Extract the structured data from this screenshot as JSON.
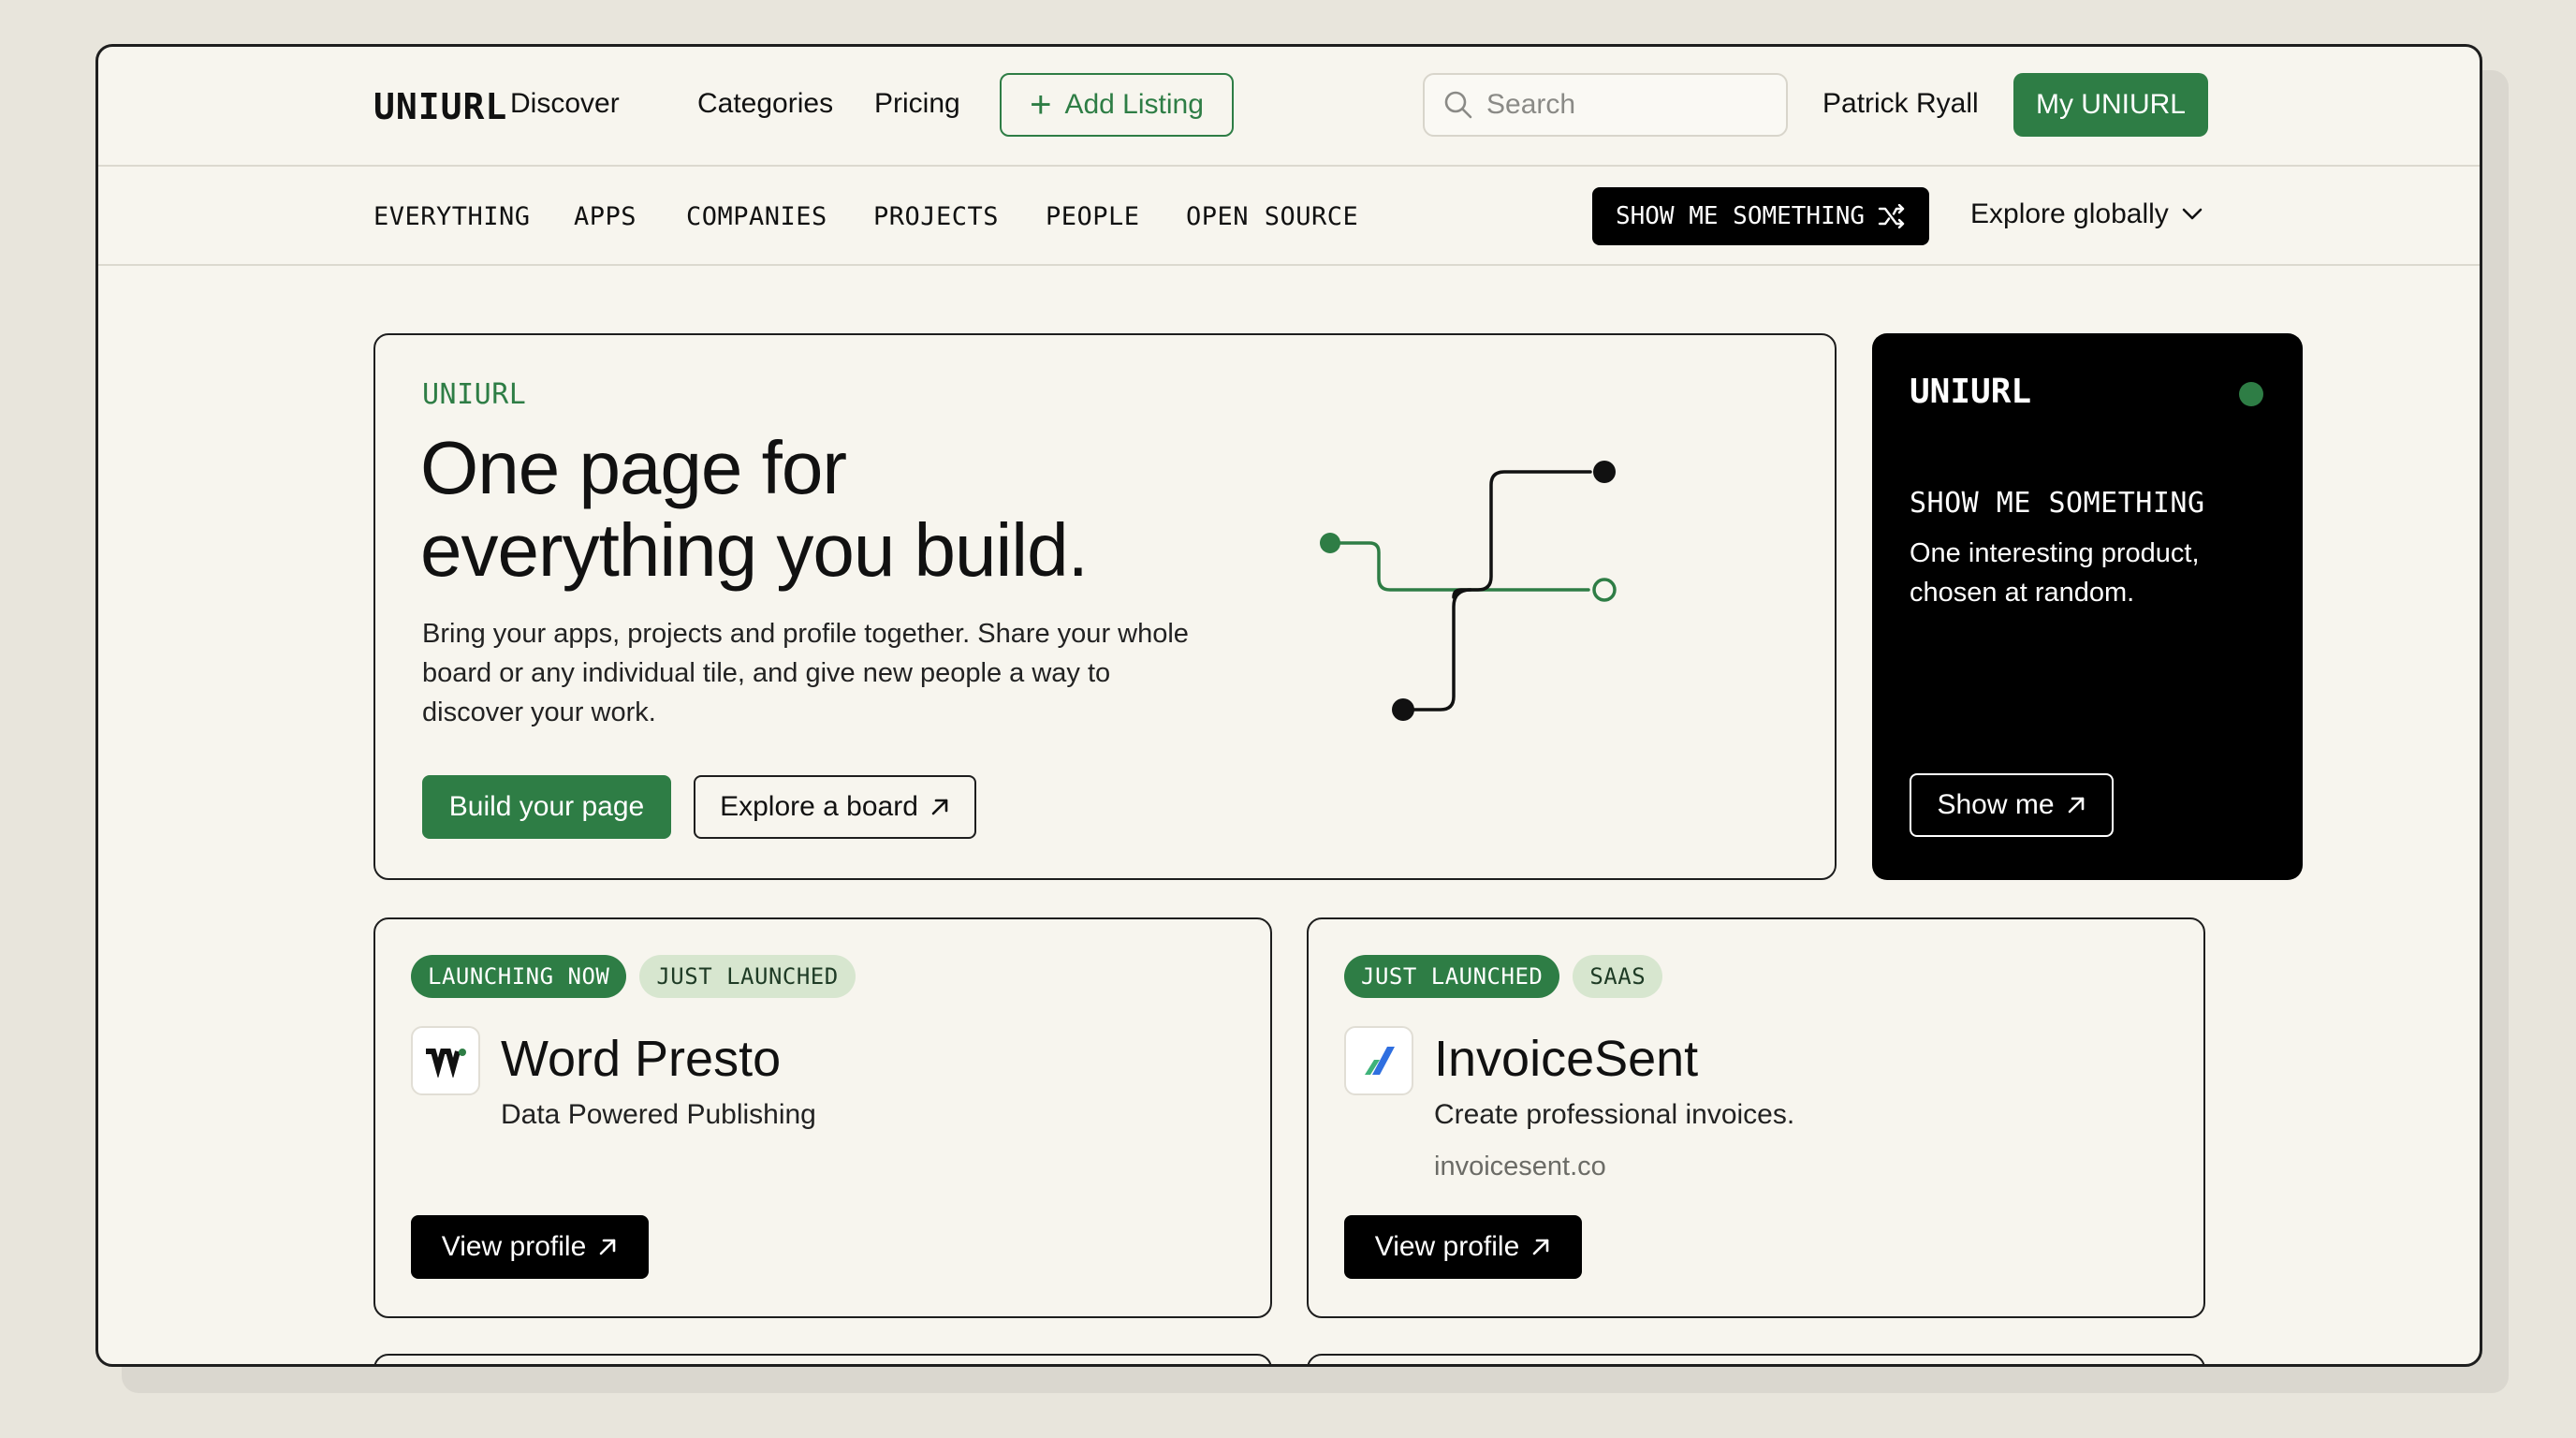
{
  "brand": "UNIURL",
  "topnav": {
    "links": [
      "Discover",
      "Categories",
      "Pricing"
    ],
    "add_listing_label": "Add Listing",
    "search_placeholder": "Search",
    "user_name": "Patrick Ryall",
    "my_button_label": "My UNIURL"
  },
  "subnav": {
    "tabs": [
      "EVERYTHING",
      "APPS",
      "COMPANIES",
      "PROJECTS",
      "PEOPLE",
      "OPEN SOURCE"
    ],
    "show_me_label": "SHOW ME SOMETHING",
    "explore_label": "Explore globally"
  },
  "hero": {
    "eyebrow": "UNIURL",
    "title_line1": "One page for",
    "title_line2": "everything you build.",
    "description": "Bring your apps, projects and profile together. Share your whole board or any individual tile, and give new people a way to discover your work.",
    "primary_button": "Build your page",
    "secondary_button": "Explore a board"
  },
  "side_card": {
    "title": "UNIURL",
    "heading": "SHOW ME SOMETHING",
    "description": "One interesting product, chosen at random.",
    "button": "Show me"
  },
  "listings": [
    {
      "badges": [
        "LAUNCHING NOW",
        "JUST LAUNCHED"
      ],
      "name": "Word Presto",
      "tagline": "Data Powered Publishing",
      "url": "",
      "button": "View profile"
    },
    {
      "badges": [
        "JUST LAUNCHED",
        "SAAS"
      ],
      "name": "InvoiceSent",
      "tagline": "Create professional invoices.",
      "url": "invoicesent.co",
      "button": "View profile"
    }
  ],
  "colors": {
    "accent": "#2e7d45",
    "badge_light": "#d7e6cf",
    "background": "#f7f5ee",
    "dark": "#000000"
  },
  "icons": [
    "plus-icon",
    "search-icon",
    "shuffle-icon",
    "chevron-down-icon",
    "arrow-up-right-icon",
    "status-dot"
  ]
}
